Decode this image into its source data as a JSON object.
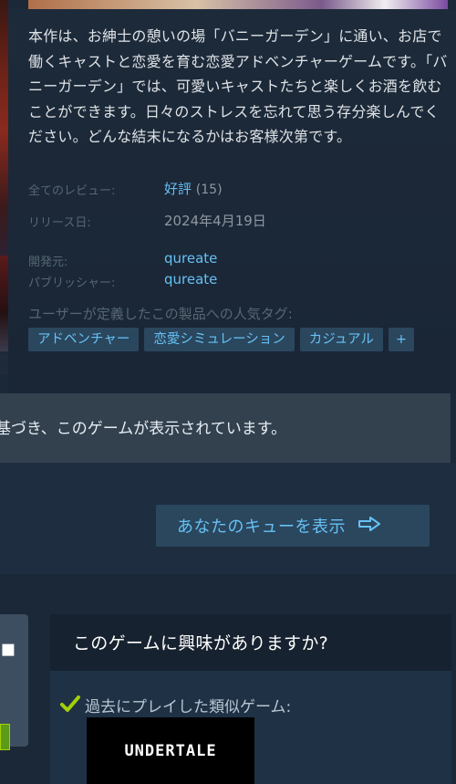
{
  "description": "本作は、お紳士の憩いの場「バニーガーデン」に通い、お店で働くキャストと恋愛を育む恋愛アドベンチャーゲームです。「バニーガーデン」では、可愛いキャストたちと楽しくお酒を飲むことができます。日々のストレスを忘れて思う存分楽しんでください。どんな結末になるかはお客様次第です。",
  "info": {
    "reviews_label": "全てのレビュー:",
    "reviews_value": "好評",
    "reviews_count": "(15)",
    "release_label": "リリース日:",
    "release_value": "2024年4月19日",
    "developer_label": "開発元:",
    "developer_value": "qureate",
    "publisher_label": "パブリッシャー:",
    "publisher_value": "qureate"
  },
  "tags": {
    "heading": "ユーザーが定義したこの製品への人気タグ:",
    "items": [
      "アドベンチャー",
      "恋愛シミュレーション",
      "カジュアル"
    ],
    "plus": "+"
  },
  "banner": {
    "text": "基づき、このゲームが表示されています。"
  },
  "queue": {
    "label": "あなたのキューを表示",
    "icon": "arrow-right-icon"
  },
  "interest": {
    "title": "このゲームに興味がありますか?",
    "similar_label": "過去にプレイした類似ゲーム:",
    "similar_game_logo": "UNDERTALE",
    "check_icon": "check-icon"
  },
  "colors": {
    "accent": "#66c0f4",
    "background": "#1b2838",
    "tag_bg": "#2a475e",
    "check_green": "#a4d007"
  }
}
